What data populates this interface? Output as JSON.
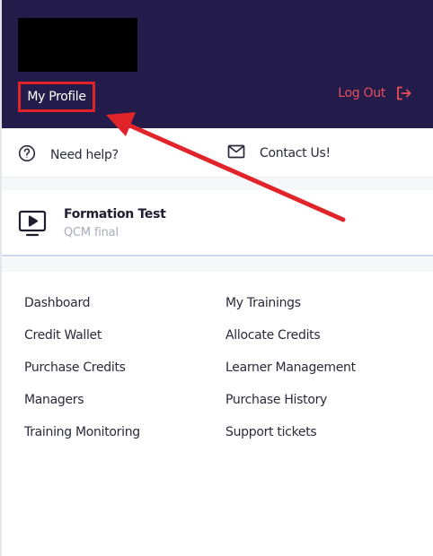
{
  "header": {
    "profile_label": "My Profile",
    "logout_label": "Log Out"
  },
  "help": {
    "need_help_label": "Need help?",
    "contact_label": "Contact Us!"
  },
  "course": {
    "title": "Formation Test",
    "subtitle": "QCM final"
  },
  "menu": {
    "left": [
      "Dashboard",
      "Credit Wallet",
      "Purchase Credits",
      "Managers",
      "Training Monitoring"
    ],
    "right": [
      "My Trainings",
      "Allocate Credits",
      "Learner Management",
      "Purchase History",
      "Support tickets"
    ]
  },
  "colors": {
    "header_bg": "#241c4a",
    "accent_red": "#e0242a",
    "logout_color": "#e8505b"
  },
  "icons": {
    "help": "question-circle-icon",
    "contact": "envelope-icon",
    "logout": "logout-arrow-icon",
    "course": "video-play-icon"
  }
}
